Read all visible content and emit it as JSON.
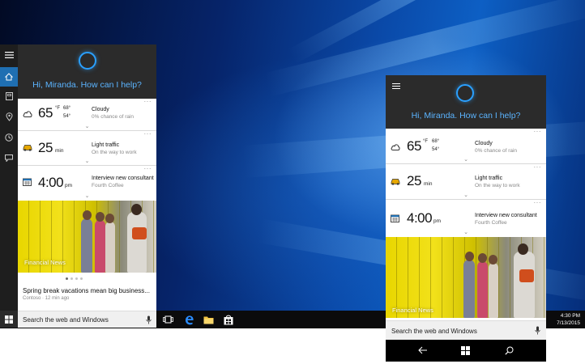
{
  "desktop_cortana": {
    "greeting": "Hi, Miranda. How can I help?",
    "weather": {
      "temp": "65",
      "unit": "°F",
      "high": "68°",
      "low": "54°",
      "condition": "Cloudy",
      "detail": "0% chance of rain"
    },
    "traffic": {
      "minutes": "25",
      "unit": "min",
      "title": "Light traffic",
      "detail": "On the way to work"
    },
    "meeting": {
      "time": "4:00",
      "ampm": "pm",
      "title": "Interview new consultant",
      "detail": "Fourth Coffee"
    },
    "news": {
      "category": "Financial News",
      "headline": "Spring break vacations mean big business...",
      "source": "Contoso · 12 min ago"
    },
    "search_placeholder": "Search the web and Windows"
  },
  "phone_cortana": {
    "greeting": "Hi, Miranda. How can I help?",
    "weather": {
      "temp": "65",
      "unit": "°F",
      "high": "68°",
      "low": "54°",
      "condition": "Cloudy",
      "detail": "0% chance of rain"
    },
    "traffic": {
      "minutes": "25",
      "unit": "min",
      "title": "Light traffic",
      "detail": "On the way to work"
    },
    "meeting": {
      "time": "4:00",
      "ampm": "pm",
      "title": "Interview new consultant",
      "detail": "Fourth Coffee"
    },
    "news": {
      "category": "Financial News"
    },
    "search_placeholder": "Search the web and Windows"
  },
  "taskbar": {
    "time": "4:30 PM",
    "date": "7/13/2015"
  },
  "colors": {
    "cortana_blue": "#2aa0ff",
    "header_dark": "#2b2b2b",
    "rail_active": "#1f6fb2",
    "rail_bg": "#1e1e1e"
  },
  "icons": {
    "rail": [
      "hamburger-icon",
      "home-icon",
      "notebook-icon",
      "location-icon",
      "reminders-icon",
      "feedback-icon"
    ],
    "taskbar": [
      "windows-start-icon",
      "task-view-icon",
      "edge-icon",
      "file-explorer-icon",
      "store-icon"
    ],
    "phone_nav": [
      "back-icon",
      "windows-icon",
      "search-icon"
    ]
  }
}
